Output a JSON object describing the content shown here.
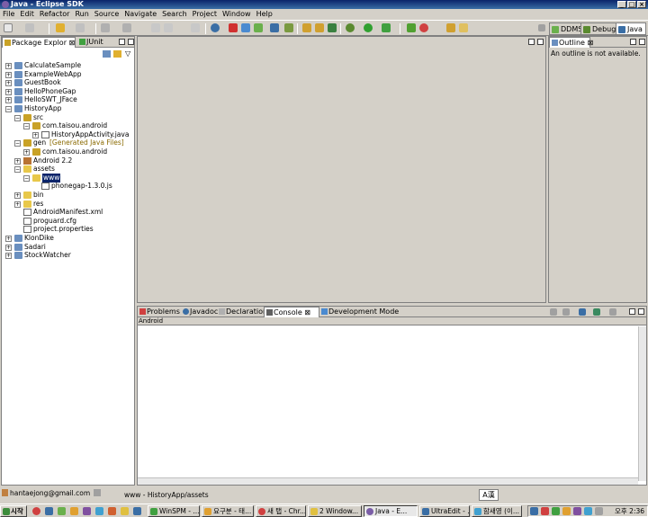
{
  "window": {
    "title": "Java - Eclipse SDK"
  },
  "menu": [
    "File",
    "Edit",
    "Refactor",
    "Run",
    "Source",
    "Navigate",
    "Search",
    "Project",
    "Window",
    "Help"
  ],
  "perspectives": [
    {
      "label": "DDMS",
      "active": false
    },
    {
      "label": "Debug",
      "active": false
    },
    {
      "label": "Java",
      "active": true
    }
  ],
  "package_explorer": {
    "tabs": [
      "Package Explor",
      "JUnit"
    ],
    "tree": [
      {
        "label": "CalculateSample",
        "level": 0,
        "type": "project",
        "expanded": false
      },
      {
        "label": "ExampleWebApp",
        "level": 0,
        "type": "project",
        "expanded": false
      },
      {
        "label": "GuestBook",
        "level": 0,
        "type": "project",
        "expanded": false
      },
      {
        "label": "HelloPhoneGap",
        "level": 0,
        "type": "project",
        "expanded": false
      },
      {
        "label": "HelloSWT_JFace",
        "level": 0,
        "type": "project",
        "expanded": false
      },
      {
        "label": "HistoryApp",
        "level": 0,
        "type": "project",
        "expanded": true
      },
      {
        "label": "src",
        "level": 1,
        "type": "srcfolder",
        "expanded": true
      },
      {
        "label": "com.taisou.android",
        "level": 2,
        "type": "package",
        "expanded": true
      },
      {
        "label": "HistoryAppActivity.java",
        "level": 3,
        "type": "java",
        "expanded": false
      },
      {
        "label": "gen",
        "suffix": "[Generated Java Files]",
        "level": 1,
        "type": "srcfolder",
        "expanded": true
      },
      {
        "label": "com.taisou.android",
        "level": 2,
        "type": "package",
        "expanded": false
      },
      {
        "label": "Android 2.2",
        "level": 1,
        "type": "library",
        "expanded": false
      },
      {
        "label": "assets",
        "level": 1,
        "type": "folder",
        "expanded": true
      },
      {
        "label": "www",
        "level": 2,
        "type": "folder",
        "expanded": true,
        "selected": true
      },
      {
        "label": "phonegap-1.3.0.js",
        "level": 3,
        "type": "file",
        "expanded": false
      },
      {
        "label": "bin",
        "level": 1,
        "type": "folder",
        "expanded": false
      },
      {
        "label": "res",
        "level": 1,
        "type": "folder",
        "expanded": false
      },
      {
        "label": "AndroidManifest.xml",
        "level": 1,
        "type": "file",
        "expanded": false
      },
      {
        "label": "proguard.cfg",
        "level": 1,
        "type": "file",
        "expanded": false
      },
      {
        "label": "project.properties",
        "level": 1,
        "type": "file",
        "expanded": false
      },
      {
        "label": "KlonDike",
        "level": 0,
        "type": "project",
        "expanded": false
      },
      {
        "label": "Sadari",
        "level": 0,
        "type": "project",
        "expanded": false
      },
      {
        "label": "StockWatcher",
        "level": 0,
        "type": "project",
        "expanded": false
      }
    ]
  },
  "outline": {
    "tab": "Outline",
    "message": "An outline is not available."
  },
  "bottom_panel": {
    "tabs": [
      "Problems",
      "Javadoc",
      "Declaration",
      "Console",
      "Development Mode"
    ],
    "active_tab": "Console",
    "console_header": "Android"
  },
  "status": {
    "account": "hantaejong@gmail.com",
    "path": "www - HistoryApp/assets",
    "ime": "A漢"
  },
  "taskbar": {
    "start": "시작",
    "tasks": [
      "WinSPM - ...",
      "요구분 - 태...",
      "새 탭 - Chr...",
      "2 Window...",
      "Java - E...",
      "UltraEdit - ...",
      "함새영 (이..."
    ],
    "active_task": "Java - E...",
    "clock": "오후 2:36"
  },
  "colors": {
    "title_bar": "#0a246a",
    "selection": "#0a246a",
    "taskbar_start": "#3c8c3c"
  }
}
